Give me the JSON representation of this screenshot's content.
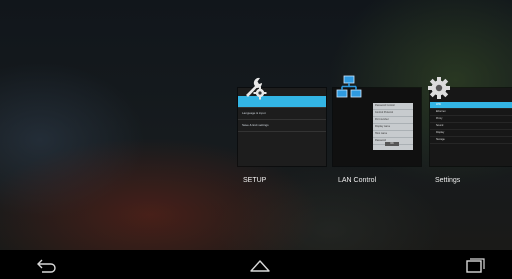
{
  "recents": [
    {
      "id": "setup",
      "label": "SETUP",
      "icon": "wrench-gear-icon",
      "thumbnail_rows": [
        "",
        "Language & input",
        "Save & Exit settings"
      ]
    },
    {
      "id": "lan",
      "label": "LAN Control",
      "icon": "network-icon",
      "thumbnail_rows": [
        "Password Control",
        "Control Protocol",
        "Port number",
        "Display name",
        "Host name",
        "Password"
      ],
      "thumbnail_button": "OK"
    },
    {
      "id": "settings",
      "label": "Settings",
      "icon": "settings-gear-icon",
      "thumbnail_rows": [
        "WiFi",
        "Ethernet",
        "Proxy",
        "",
        "Sound",
        "Display",
        "Storage"
      ]
    }
  ],
  "navbar": {
    "back": "back-icon",
    "home": "home-icon",
    "recents": "recent-apps-icon"
  },
  "colors": {
    "accent": "#33b5e5",
    "navbar_bg": "#000000"
  }
}
